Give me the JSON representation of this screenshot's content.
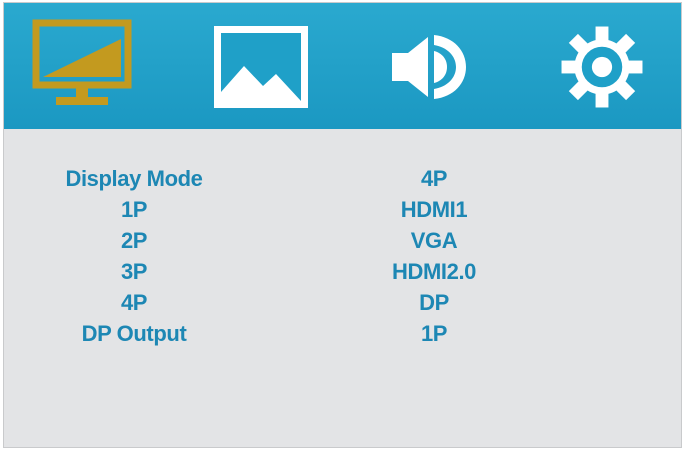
{
  "tabs": [
    {
      "name": "display",
      "icon": "monitor-icon",
      "active": true
    },
    {
      "name": "picture",
      "icon": "picture-icon",
      "active": false
    },
    {
      "name": "audio",
      "icon": "speaker-icon",
      "active": false
    },
    {
      "name": "settings",
      "icon": "gear-icon",
      "active": false
    }
  ],
  "colors": {
    "header": "#1fa0c8",
    "active_icon": "#c39a1f",
    "inactive_icon": "#ffffff",
    "text": "#1d87b4",
    "panel": "#e3e4e6"
  },
  "menu": {
    "rows": [
      {
        "label": "Display Mode",
        "value": "4P"
      },
      {
        "label": "1P",
        "value": "HDMI1"
      },
      {
        "label": "2P",
        "value": "VGA"
      },
      {
        "label": "3P",
        "value": "HDMI2.0"
      },
      {
        "label": "4P",
        "value": "DP"
      },
      {
        "label": "DP Output",
        "value": "1P"
      }
    ]
  }
}
